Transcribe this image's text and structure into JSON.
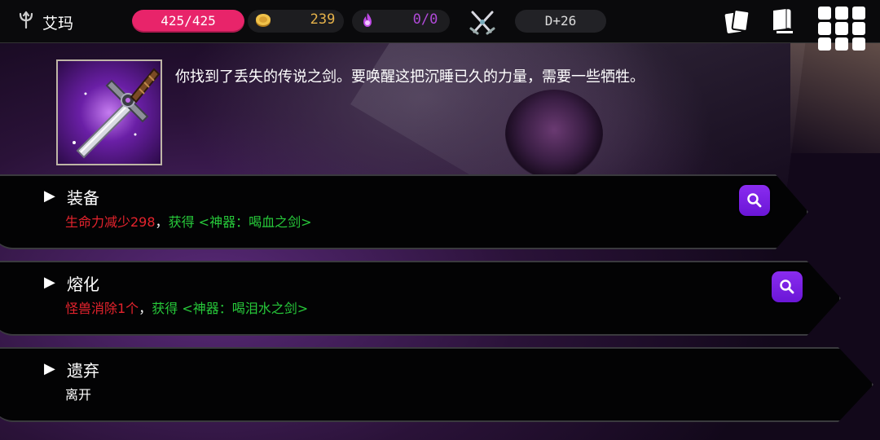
{
  "topbar": {
    "hero_name": "艾玛",
    "hp": "425/425",
    "gold": "239",
    "souls": "0/0",
    "depth": "D+26"
  },
  "event": {
    "text": "你找到了丢失的传说之剑。要唤醒这把沉睡已久的力量，需要一些牺牲。"
  },
  "options": [
    {
      "title": "装备",
      "cost": "生命力减少298",
      "sep": "，",
      "reward_prefix": "获得",
      "reward": "<神器：喝血之剑>"
    },
    {
      "title": "熔化",
      "cost": "怪兽消除1个",
      "sep": "，",
      "reward_prefix": "获得",
      "reward": "<神器：喝泪水之剑>"
    },
    {
      "title": "遗弃",
      "desc": "离开"
    }
  ],
  "colors": {
    "hp": "#e8246a",
    "gold": "#e6b24a",
    "souls": "#b04ad8",
    "cost": "#e5232d",
    "reward": "#27c93a",
    "inspect": "#7a22e6"
  },
  "icons": {
    "hero": "trident-icon",
    "gold": "coin-icon",
    "souls": "soul-flame-icon",
    "depth": "crossed-swords-icon",
    "deck": "cards-icon",
    "map": "map-icon",
    "menu": "grid-menu-icon",
    "inspect": "magnifier-icon"
  }
}
